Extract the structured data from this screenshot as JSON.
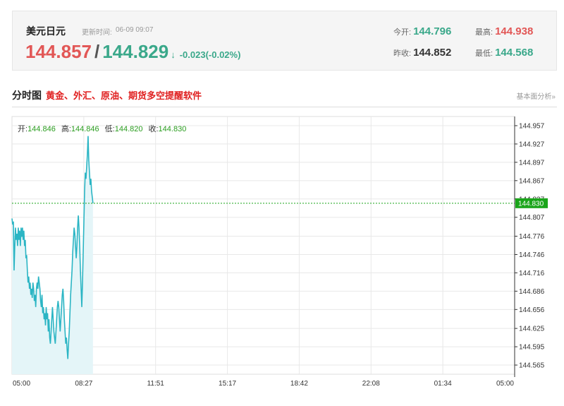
{
  "quote": {
    "name": "美元日元",
    "update_label": "更新时间:",
    "update_time": "06-09 09:07",
    "bid": "144.857",
    "separator": "/",
    "ask": "144.829",
    "arrow": "↓",
    "change": "-0.023(-0.02%)",
    "open_label": "今开:",
    "open": "144.796",
    "high_label": "最高:",
    "high": "144.938",
    "prev_close_label": "昨收:",
    "prev_close": "144.852",
    "low_label": "最低:",
    "low": "144.568"
  },
  "section": {
    "title": "分时图",
    "promo": "黄金、外汇、原油、期货多空提醒软件",
    "basic_link": "基本面分析»"
  },
  "ohlc": {
    "open_label": "开:",
    "open": "144.846",
    "high_label": "高:",
    "high": "144.846",
    "low_label": "低:",
    "low": "144.820",
    "close_label": "收:",
    "close": "144.830"
  },
  "colors": {
    "line": "#2bb5c4",
    "fill": "#e4f5f8",
    "current_tag": "#1aa51a",
    "grid": "#e8e8e8"
  },
  "chart_data": {
    "type": "area",
    "x_ticks": [
      "05:00",
      "08:27",
      "11:51",
      "15:17",
      "18:42",
      "22:08",
      "01:34",
      "05:00"
    ],
    "y_ticks": [
      "144.565",
      "144.595",
      "144.625",
      "144.656",
      "144.686",
      "144.716",
      "144.746",
      "144.776",
      "144.807",
      "144.837",
      "144.867",
      "144.897",
      "144.927",
      "144.957"
    ],
    "ylim": [
      144.55,
      144.972
    ],
    "x_range_minutes": [
      0,
      1440
    ],
    "current_value": 144.83,
    "current_label": "144.830",
    "points": [
      [
        0,
        144.805
      ],
      [
        2,
        144.795
      ],
      [
        4,
        144.8
      ],
      [
        6,
        144.72
      ],
      [
        8,
        144.76
      ],
      [
        10,
        144.79
      ],
      [
        12,
        144.77
      ],
      [
        14,
        144.78
      ],
      [
        16,
        144.76
      ],
      [
        18,
        144.79
      ],
      [
        20,
        144.77
      ],
      [
        22,
        144.785
      ],
      [
        24,
        144.76
      ],
      [
        26,
        144.79
      ],
      [
        28,
        144.775
      ],
      [
        30,
        144.79
      ],
      [
        32,
        144.77
      ],
      [
        34,
        144.785
      ],
      [
        36,
        144.76
      ],
      [
        38,
        144.77
      ],
      [
        40,
        144.74
      ],
      [
        42,
        144.745
      ],
      [
        44,
        144.72
      ],
      [
        46,
        144.7
      ],
      [
        48,
        144.71
      ],
      [
        50,
        144.69
      ],
      [
        52,
        144.7
      ],
      [
        54,
        144.68
      ],
      [
        56,
        144.69
      ],
      [
        58,
        144.675
      ],
      [
        60,
        144.7
      ],
      [
        62,
        144.69
      ],
      [
        64,
        144.67
      ],
      [
        66,
        144.68
      ],
      [
        68,
        144.66
      ],
      [
        70,
        144.69
      ],
      [
        72,
        144.7
      ],
      [
        74,
        144.69
      ],
      [
        76,
        144.71
      ],
      [
        78,
        144.7
      ],
      [
        80,
        144.69
      ],
      [
        82,
        144.67
      ],
      [
        84,
        144.66
      ],
      [
        86,
        144.68
      ],
      [
        88,
        144.65
      ],
      [
        90,
        144.66
      ],
      [
        92,
        144.64
      ],
      [
        94,
        144.65
      ],
      [
        96,
        144.63
      ],
      [
        98,
        144.66
      ],
      [
        100,
        144.64
      ],
      [
        102,
        144.65
      ],
      [
        104,
        144.62
      ],
      [
        106,
        144.64
      ],
      [
        108,
        144.61
      ],
      [
        110,
        144.6
      ],
      [
        112,
        144.62
      ],
      [
        114,
        144.64
      ],
      [
        116,
        144.66
      ],
      [
        118,
        144.64
      ],
      [
        120,
        144.62
      ],
      [
        122,
        144.61
      ],
      [
        124,
        144.6
      ],
      [
        126,
        144.62
      ],
      [
        128,
        144.64
      ],
      [
        130,
        144.66
      ],
      [
        132,
        144.67
      ],
      [
        134,
        144.66
      ],
      [
        136,
        144.64
      ],
      [
        138,
        144.62
      ],
      [
        140,
        144.64
      ],
      [
        142,
        144.66
      ],
      [
        144,
        144.68
      ],
      [
        146,
        144.69
      ],
      [
        148,
        144.67
      ],
      [
        150,
        144.64
      ],
      [
        152,
        144.62
      ],
      [
        154,
        144.6
      ],
      [
        156,
        144.61
      ],
      [
        158,
        144.59
      ],
      [
        160,
        144.575
      ],
      [
        162,
        144.6
      ],
      [
        164,
        144.62
      ],
      [
        166,
        144.65
      ],
      [
        168,
        144.68
      ],
      [
        170,
        144.7
      ],
      [
        172,
        144.72
      ],
      [
        174,
        144.75
      ],
      [
        176,
        144.77
      ],
      [
        178,
        144.79
      ],
      [
        180,
        144.78
      ],
      [
        182,
        144.76
      ],
      [
        184,
        144.74
      ],
      [
        186,
        144.76
      ],
      [
        188,
        144.79
      ],
      [
        190,
        144.81
      ],
      [
        192,
        144.79
      ],
      [
        194,
        144.76
      ],
      [
        196,
        144.72
      ],
      [
        198,
        144.69
      ],
      [
        200,
        144.66
      ],
      [
        202,
        144.7
      ],
      [
        204,
        144.75
      ],
      [
        206,
        144.8
      ],
      [
        208,
        144.85
      ],
      [
        210,
        144.88
      ],
      [
        212,
        144.87
      ],
      [
        214,
        144.89
      ],
      [
        216,
        144.91
      ],
      [
        218,
        144.94
      ],
      [
        220,
        144.9
      ],
      [
        222,
        144.88
      ],
      [
        224,
        144.86
      ],
      [
        226,
        144.87
      ],
      [
        228,
        144.85
      ],
      [
        230,
        144.84
      ],
      [
        232,
        144.83
      ]
    ]
  }
}
